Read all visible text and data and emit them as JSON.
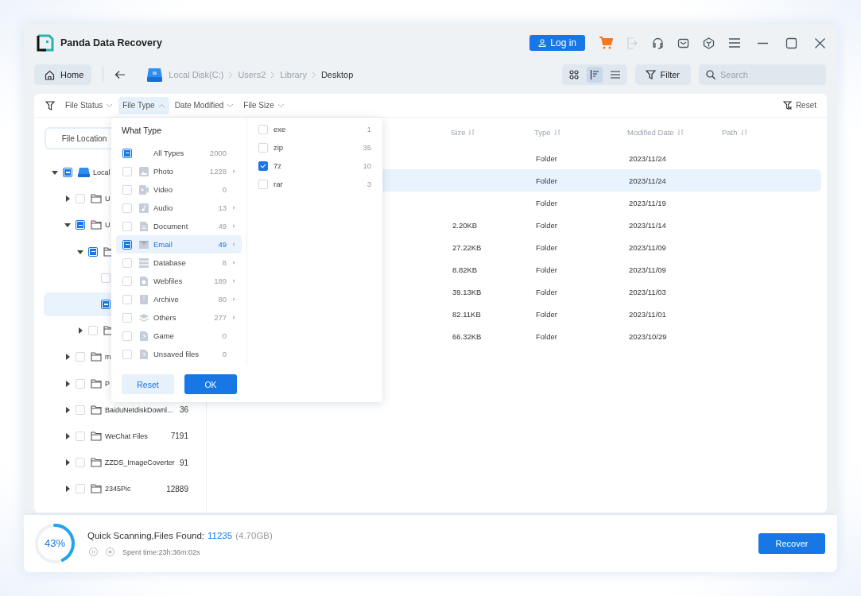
{
  "window": {
    "title": "Panda Data Recovery"
  },
  "title_bar": {
    "login_button": "Log in"
  },
  "nav": {
    "home": "Home",
    "breadcrumb": [
      {
        "label": "Local Disk(C:)",
        "current": false
      },
      {
        "label": "Users2",
        "current": false
      },
      {
        "label": "Library",
        "current": false
      },
      {
        "label": "Desktop",
        "current": true
      }
    ],
    "views": [
      {
        "kind": "grid",
        "selected": false
      },
      {
        "kind": "detail",
        "selected": true
      },
      {
        "kind": "list",
        "selected": false
      }
    ],
    "filter_button": "Filter",
    "search": {
      "placeholder": "Search"
    }
  },
  "filter_bar": {
    "filters": [
      {
        "label": "File Status",
        "expanded": false
      },
      {
        "label": "File Type",
        "expanded": true
      },
      {
        "label": "Date Modified",
        "expanded": false
      },
      {
        "label": "File Size",
        "expanded": false
      }
    ],
    "reset": "Reset"
  },
  "sidebar": {
    "tab": "File Location",
    "tree": [
      {
        "kind": "drive",
        "label": "Local",
        "expanded": true,
        "checked": false,
        "indeterminate": true,
        "selected": false,
        "children": [
          {
            "kind": "folder",
            "label": "U",
            "expanded": false,
            "checked": false,
            "indeterminate": false,
            "selected": false
          },
          {
            "kind": "folder",
            "label": "U",
            "expanded": true,
            "checked": false,
            "indeterminate": true,
            "selected": false,
            "children": [
              {
                "kind": "folder",
                "expanded": true,
                "checked": false,
                "indeterminate": true,
                "selected": false,
                "children": [
                  {
                    "checked": false,
                    "indeterminate": false,
                    "selected": false
                  },
                  {
                    "checked": false,
                    "indeterminate": true,
                    "selected": true
                  }
                ]
              },
              {
                "kind": "folder",
                "expanded": false,
                "checked": false,
                "indeterminate": false,
                "selected": false
              }
            ]
          },
          {
            "kind": "folder",
            "label": "m",
            "expanded": false,
            "checked": false,
            "indeterminate": false,
            "selected": false
          },
          {
            "kind": "folder",
            "label": "P",
            "expanded": false,
            "checked": false,
            "indeterminate": false,
            "selected": false
          },
          {
            "kind": "folder",
            "label": "BaiduNetdiskDownl...",
            "count": "36",
            "expanded": false,
            "checked": false,
            "indeterminate": false,
            "selected": false
          },
          {
            "kind": "folder",
            "label": "WeChat Files",
            "count": "7191",
            "expanded": false,
            "checked": false,
            "indeterminate": false,
            "selected": false
          },
          {
            "kind": "folder",
            "label": "ZZDS_ImageCoverter",
            "count": "91",
            "expanded": false,
            "checked": false,
            "indeterminate": false,
            "selected": false
          },
          {
            "kind": "folder",
            "label": "2345Pic",
            "count": "12889",
            "expanded": false,
            "checked": false,
            "indeterminate": false,
            "selected": false
          }
        ]
      }
    ]
  },
  "table": {
    "columns": [
      "Size",
      "Type",
      "Modified Date",
      "Path"
    ],
    "rows": [
      {
        "type": "Folder",
        "modified": "2023/11/24",
        "selected": false
      },
      {
        "type": "Folder",
        "modified": "2023/11/24",
        "selected": true
      },
      {
        "type": "Folder",
        "modified": "2023/11/19",
        "selected": false
      },
      {
        "size": "2.20KB",
        "type": "Folder",
        "modified": "2023/11/14",
        "selected": false
      },
      {
        "size": "27.22KB",
        "type": "Folder",
        "modified": "2023/11/09",
        "selected": false
      },
      {
        "size": "8.82KB",
        "type": "Folder",
        "modified": "2023/11/09",
        "selected": false
      },
      {
        "size": "39.13KB",
        "type": "Folder",
        "modified": "2023/11/03",
        "selected": false
      },
      {
        "size": "82.11KB",
        "type": "Folder",
        "modified": "2023/11/01",
        "selected": false
      },
      {
        "size": "66.32KB",
        "type": "Folder",
        "modified": "2023/10/29",
        "selected": false
      }
    ]
  },
  "type_menu": {
    "title": "What Type",
    "types": [
      {
        "kind": "all",
        "label": "All Types",
        "count": "2000",
        "has_sub": false,
        "checked": false,
        "indeterminate": true,
        "selected": false
      },
      {
        "kind": "photo",
        "label": "Photo",
        "count": "1228",
        "has_sub": true,
        "checked": false,
        "indeterminate": false,
        "selected": false
      },
      {
        "kind": "video",
        "label": "Video",
        "count": "0",
        "has_sub": false,
        "checked": false,
        "indeterminate": false,
        "selected": false
      },
      {
        "kind": "audio",
        "label": "Audio",
        "count": "13",
        "has_sub": true,
        "checked": false,
        "indeterminate": false,
        "selected": false
      },
      {
        "kind": "document",
        "label": "Document",
        "count": "49",
        "has_sub": true,
        "checked": false,
        "indeterminate": false,
        "selected": false
      },
      {
        "kind": "email",
        "label": "Email",
        "count": "49",
        "has_sub": true,
        "checked": false,
        "indeterminate": true,
        "selected": true
      },
      {
        "kind": "database",
        "label": "Database",
        "count": "8",
        "has_sub": true,
        "checked": false,
        "indeterminate": false,
        "selected": false
      },
      {
        "kind": "web",
        "label": "Webfiles",
        "count": "189",
        "has_sub": true,
        "checked": false,
        "indeterminate": false,
        "selected": false
      },
      {
        "kind": "archive",
        "label": "Archive",
        "count": "80",
        "has_sub": true,
        "checked": false,
        "indeterminate": false,
        "selected": false
      },
      {
        "kind": "others",
        "label": "Others",
        "count": "277",
        "has_sub": true,
        "checked": false,
        "indeterminate": false,
        "selected": false
      },
      {
        "kind": "unknown",
        "label": "Game",
        "count": "0",
        "has_sub": false,
        "checked": false,
        "indeterminate": false,
        "selected": false
      },
      {
        "kind": "unknown",
        "label": "Unsaved files",
        "count": "0",
        "has_sub": false,
        "checked": false,
        "indeterminate": false,
        "selected": false
      }
    ],
    "subtypes": [
      {
        "label": "exe",
        "count": "1",
        "checked": false
      },
      {
        "label": "zip",
        "count": "35",
        "checked": false
      },
      {
        "label": "7z",
        "count": "10",
        "checked": true
      },
      {
        "label": "rar",
        "count": "3",
        "checked": false
      }
    ],
    "reset_button": "Reset",
    "ok_button": "OK"
  },
  "scan": {
    "level": 0.43,
    "percent": "43%",
    "status": "Quick Scanning,Files Found:",
    "files_found": "11235",
    "total_size": "(4.70GB)",
    "spent_time": "Spent time:23h:36m:02s",
    "recover_button": "Recover"
  }
}
